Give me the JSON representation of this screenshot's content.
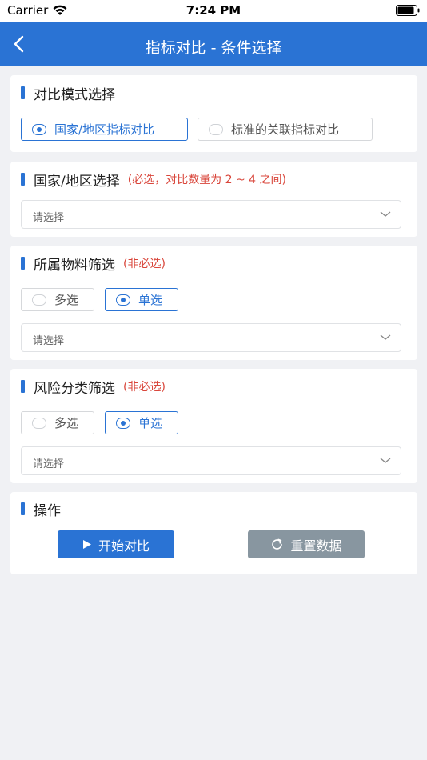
{
  "status": {
    "carrier": "Carrier",
    "time": "7:24 PM"
  },
  "nav": {
    "title": "指标对比 - 条件选择"
  },
  "compare_mode": {
    "title": "对比模式选择",
    "options": [
      "国家/地区指标对比",
      "标准的关联指标对比"
    ]
  },
  "region": {
    "title": "国家/地区选择",
    "note": "(必选，对比数量为 2 ~ 4 之间)",
    "placeholder": "请选择"
  },
  "material": {
    "title": "所属物料筛选",
    "note": "(非必选)",
    "multi_label": "多选",
    "single_label": "单选",
    "placeholder": "请选择"
  },
  "risk": {
    "title": "风险分类筛选",
    "note": "(非必选)",
    "multi_label": "多选",
    "single_label": "单选",
    "placeholder": "请选择"
  },
  "actions": {
    "title": "操作",
    "start_label": "开始对比",
    "reset_label": "重置数据"
  },
  "colors": {
    "primary": "#2a73d4",
    "danger": "#d9463b",
    "secondary": "#8896a0"
  }
}
